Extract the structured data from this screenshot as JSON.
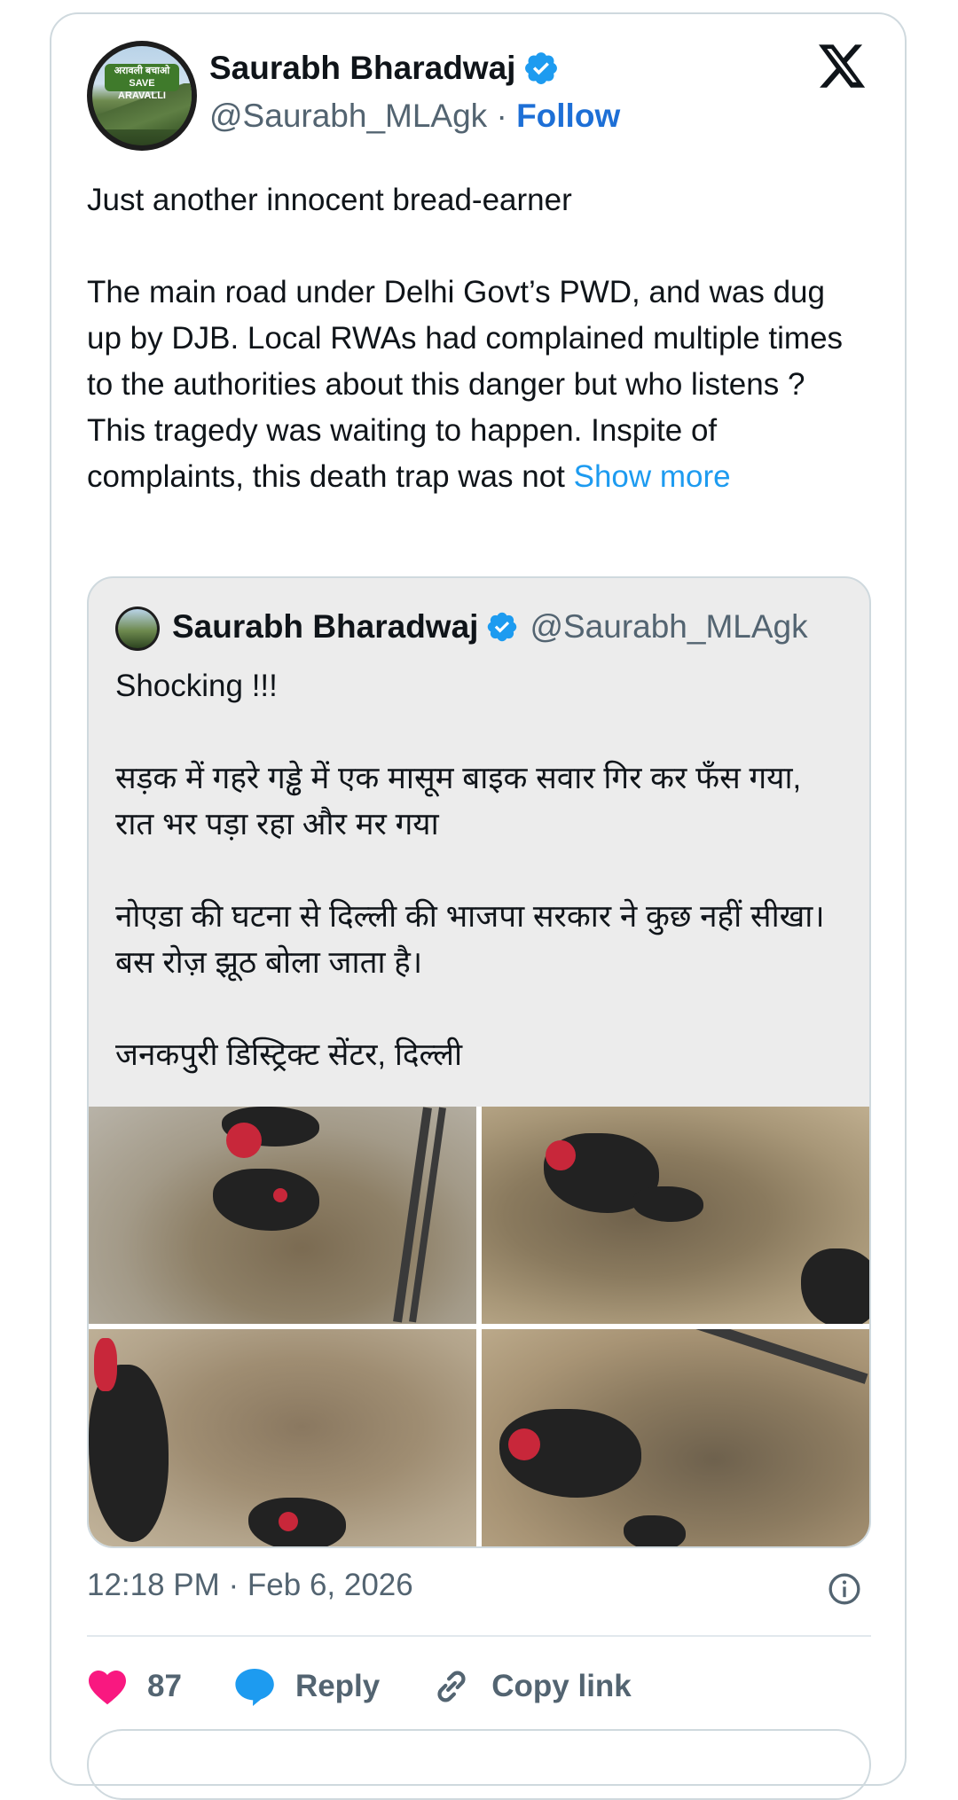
{
  "author": {
    "name": "Saurabh Bharadwaj",
    "handle": "@Saurabh_MLAgk",
    "separator": " · ",
    "follow_label": "Follow",
    "avatar_banner_text": "अरावली बचाओ SAVE ARAVALLI"
  },
  "tweet": {
    "text": "Just another innocent bread-earner\n\nThe main road under Delhi Govt’s PWD, and was dug up by DJB. Local RWAs had complained multiple times to the authorities about this danger but who listens ?\nThis tragedy was waiting to happen. Inspite of complaints, this death trap was not ",
    "show_more": "Show more"
  },
  "quote": {
    "name": "Saurabh Bharadwaj",
    "handle": "@Saurabh_MLAgk",
    "text": "Shocking !!!\n\nसड़क में गहरे गड्ढे में एक मासूम बाइक सवार गिर कर फँस गया, रात भर पड़ा रहा और मर गया\n\nनोएडा की घटना से दिल्ली की भाजपा सरकार ने कुछ नहीं सीखा। बस रोज़ झूठ बोला जाता है।\n\nजनकपुरी डिस्ट्रिक्ट सेंटर, दिल्ली"
  },
  "timestamp": "12:18 PM · Feb 6, 2026",
  "actions": {
    "likes": "87",
    "reply_label": "Reply",
    "copy_link_label": "Copy link"
  },
  "colors": {
    "accent": "#1d9bf0",
    "follow": "#1d6fd6",
    "heart": "#f91880",
    "verified": "#1d9bf0"
  },
  "icons": [
    "x-logo-icon",
    "verified-badge-icon",
    "info-icon",
    "heart-icon",
    "reply-icon",
    "link-icon"
  ]
}
